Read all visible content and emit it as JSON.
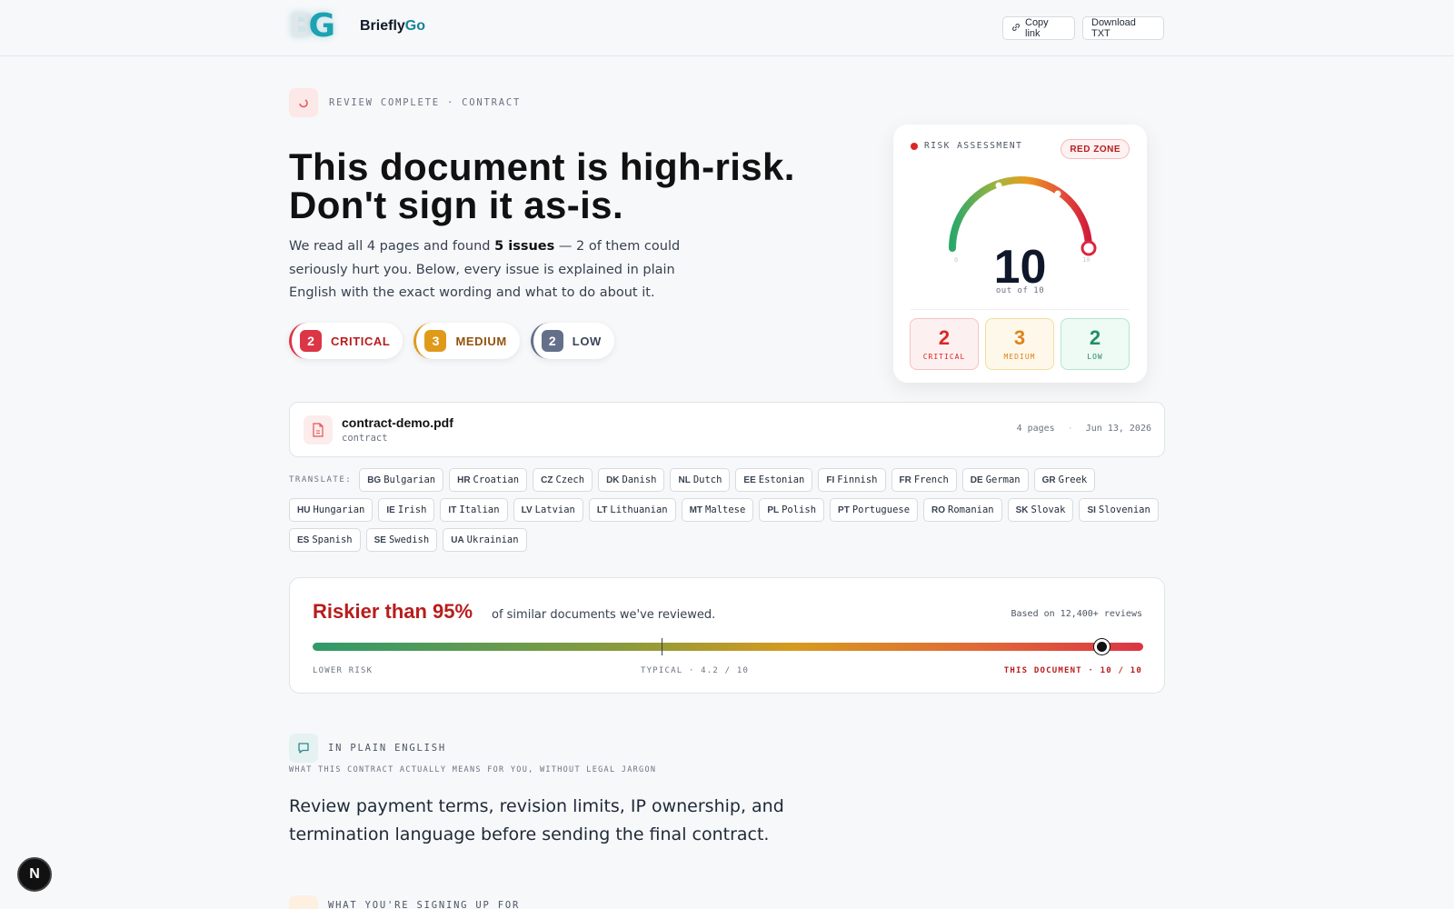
{
  "brand": {
    "name": "Briefly",
    "name_accent": "Go",
    "logo_text": "BG"
  },
  "header": {
    "copy_label": "Copy link",
    "download_label": "Download TXT"
  },
  "hero": {
    "eyebrow": "REVIEW COMPLETE · CONTRACT",
    "title_line1": "This document is high-risk.",
    "title_line2": "Don't sign it as-is.",
    "sub_pre": "We read all 4 pages and found ",
    "sub_bold": "5 issues",
    "sub_post": " — 2 of them could seriously hurt you. Below, every issue is explained in plain English with the exact wording and what to do about it.",
    "severities": [
      {
        "count": "2",
        "label": "CRITICAL",
        "color": "#dc3545",
        "text": "#b91c1c"
      },
      {
        "count": "3",
        "label": "MEDIUM",
        "color": "#e09a1a",
        "text": "#92520e"
      },
      {
        "count": "2",
        "label": "LOW",
        "color": "#64708a",
        "text": "#3b4458"
      }
    ]
  },
  "risk": {
    "title": "RISK ASSESSMENT",
    "zone": "RED ZONE",
    "score": "10",
    "out_of": "out of 10",
    "score_value": 10,
    "scale_min": "0",
    "scale_max": "10",
    "boxes": [
      {
        "count": "2",
        "label": "CRITICAL",
        "fg": "#dc2626",
        "bg": "#fdf0f0",
        "border": "#f5c2c2"
      },
      {
        "count": "3",
        "label": "MEDIUM",
        "fg": "#e0821a",
        "bg": "#fef8ea",
        "border": "#f3dd9e"
      },
      {
        "count": "2",
        "label": "LOW",
        "fg": "#1f8f63",
        "bg": "#eefaf4",
        "border": "#b6e6cd"
      }
    ]
  },
  "file": {
    "name": "contract-demo.pdf",
    "type": "contract",
    "pages": "4 pages",
    "sep": "·",
    "date": "Jun 13, 2026"
  },
  "translate": {
    "label": "TRANSLATE:",
    "languages": [
      {
        "code": "BG",
        "name": "Bulgarian"
      },
      {
        "code": "HR",
        "name": "Croatian"
      },
      {
        "code": "CZ",
        "name": "Czech"
      },
      {
        "code": "DK",
        "name": "Danish"
      },
      {
        "code": "NL",
        "name": "Dutch"
      },
      {
        "code": "EE",
        "name": "Estonian"
      },
      {
        "code": "FI",
        "name": "Finnish"
      },
      {
        "code": "FR",
        "name": "French"
      },
      {
        "code": "DE",
        "name": "German"
      },
      {
        "code": "GR",
        "name": "Greek"
      },
      {
        "code": "HU",
        "name": "Hungarian"
      },
      {
        "code": "IE",
        "name": "Irish"
      },
      {
        "code": "IT",
        "name": "Italian"
      },
      {
        "code": "LV",
        "name": "Latvian"
      },
      {
        "code": "LT",
        "name": "Lithuanian"
      },
      {
        "code": "MT",
        "name": "Maltese"
      },
      {
        "code": "PL",
        "name": "Polish"
      },
      {
        "code": "PT",
        "name": "Portuguese"
      },
      {
        "code": "RO",
        "name": "Romanian"
      },
      {
        "code": "SK",
        "name": "Slovak"
      },
      {
        "code": "SI",
        "name": "Slovenian"
      },
      {
        "code": "ES",
        "name": "Spanish"
      },
      {
        "code": "SE",
        "name": "Swedish"
      },
      {
        "code": "UA",
        "name": "Ukrainian"
      }
    ]
  },
  "comparison": {
    "headline": "Riskier than 95%",
    "rest": "of similar documents we've reviewed.",
    "based": "Based on 12,400+ reviews",
    "typical_score": 4.2,
    "this_score": 10,
    "label_low": "LOWER RISK",
    "label_typical": "TYPICAL · 4.2 / 10",
    "label_this": "THIS DOCUMENT · 10 / 10"
  },
  "plain": {
    "title": "IN PLAIN ENGLISH",
    "subtitle": "WHAT THIS CONTRACT ACTUALLY MEANS FOR YOU, WITHOUT LEGAL JARGON",
    "body": "Review payment terms, revision limits, IP ownership, and termination language before sending the final contract."
  },
  "next_section": {
    "title": "WHAT YOU'RE SIGNING UP FOR"
  },
  "badge": {
    "letter": "N"
  }
}
